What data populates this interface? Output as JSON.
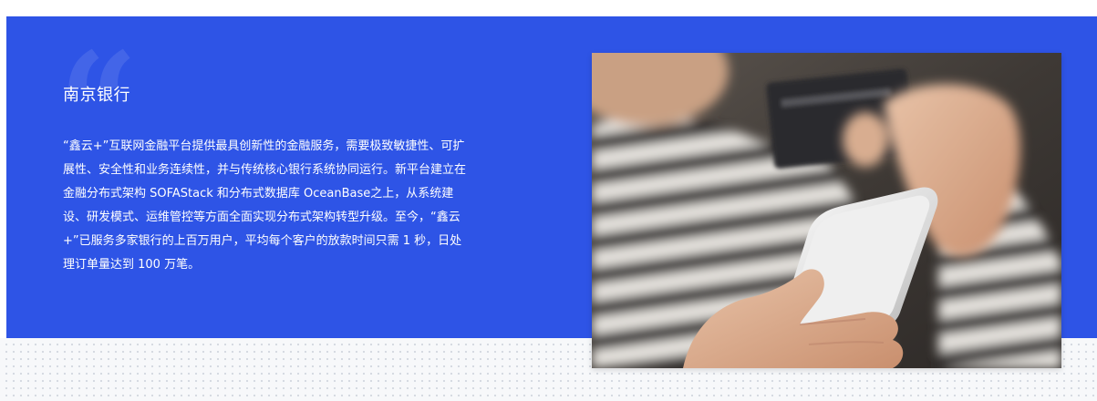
{
  "testimonial": {
    "quote_icon": "quote-icon",
    "bank_name": "南京银行",
    "description": "“鑫云+”互联网金融平台提供最具创新性的金融服务，需要极致敏捷性、可扩展性、安全性和业务连续性，并与传统核心银行系统协同运行。新平台建立在金融分布式架构 SOFAStack 和分布式数据库 OceanBase之上，从系统建设、研发模式、运维管控等方面全面实现分布式架构转型升级。至今，“鑫云+”已服务多家银行的上百万用户，平均每个客户的放款时间只需 1 秒，日处理订单量达到 100 万笔。"
  },
  "photo": {
    "subject": "person-holding-smartphone-and-credit-card"
  },
  "colors": {
    "banner_bg": "#2e54e6",
    "text": "#ffffff",
    "dot_pattern": "#d4d8e0"
  }
}
